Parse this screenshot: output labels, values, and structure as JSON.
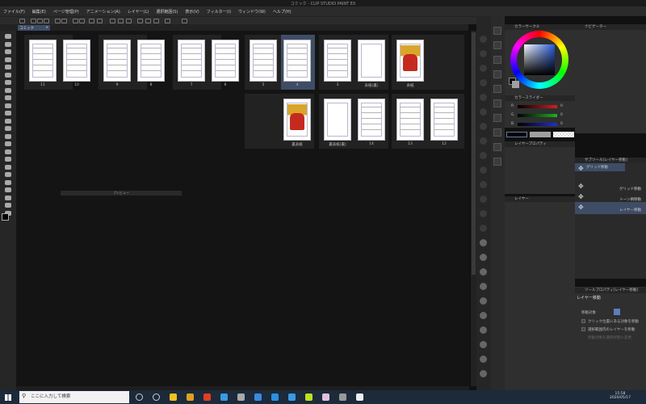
{
  "window": {
    "title": "コミック - CLIP STUDIO PAINT EX"
  },
  "menu": [
    "ファイル(F)",
    "編集(E)",
    "ページ管理(P)",
    "アニメーション(A)",
    "レイヤー(L)",
    "選択範囲(S)",
    "表示(V)",
    "フィルター(I)",
    "ウィンドウ(W)",
    "ヘルプ(H)"
  ],
  "tab": {
    "label": "コミック",
    "close": "×"
  },
  "spreads": [
    {
      "row": 0,
      "pages": [
        {
          "label": "11",
          "kind": "ink"
        },
        {
          "label": "10",
          "kind": "ink"
        }
      ]
    },
    {
      "row": 0,
      "pages": [
        {
          "label": "9",
          "kind": "ink"
        },
        {
          "label": "8",
          "kind": "ink"
        }
      ]
    },
    {
      "row": 0,
      "pages": [
        {
          "label": "7",
          "kind": "ink"
        },
        {
          "label": "6",
          "kind": "ink"
        }
      ]
    },
    {
      "row": 0,
      "pages": [
        {
          "label": "5",
          "kind": "ink"
        },
        {
          "label": "4",
          "kind": "ink",
          "selected": true
        }
      ]
    },
    {
      "row": 0,
      "pages": [
        {
          "label": "3",
          "kind": "ink"
        },
        {
          "label": "表紙(裏)",
          "kind": "blank"
        }
      ]
    },
    {
      "row": 0,
      "pages": [
        {
          "label": "表紙",
          "kind": "color"
        }
      ]
    },
    {
      "row": 1,
      "pages": [
        {
          "label": "",
          "kind": "none"
        },
        {
          "label": "裏表紙",
          "kind": "color"
        }
      ]
    },
    {
      "row": 1,
      "pages": [
        {
          "label": "裏表紙(裏)",
          "kind": "blank"
        },
        {
          "label": "14",
          "kind": "ink"
        }
      ]
    },
    {
      "row": 1,
      "pages": [
        {
          "label": "13",
          "kind": "ink"
        },
        {
          "label": "12",
          "kind": "ink"
        }
      ]
    }
  ],
  "preview": {
    "title": "プレビュー"
  },
  "color_panel": {
    "title": "カラーサークル",
    "main_color": "#000000",
    "sub_color": "#a0a0a0"
  },
  "color_slider": {
    "title": "カラースライダー",
    "tab2": "中間色",
    "channels": [
      {
        "name": "R",
        "value": "0",
        "color": "#d02020"
      },
      {
        "name": "G",
        "value": "0",
        "color": "#20b020"
      },
      {
        "name": "B",
        "value": "0",
        "color": "#2030d0"
      }
    ]
  },
  "navigator": {
    "title": "ナビゲーター"
  },
  "layer_property": {
    "title": "レイヤープロパティ",
    "tab2": "レイヤー検索"
  },
  "layers": {
    "title": "レイヤー"
  },
  "subtool": {
    "title": "サブツール[レイヤー移動]",
    "items": [
      {
        "label": "グリッド移動",
        "selected": true
      },
      {
        "label": "グリッド移動"
      },
      {
        "label": "トーン柄移動"
      },
      {
        "label": "レイヤー移動",
        "selected": true
      }
    ]
  },
  "tool_property": {
    "title": "ツールプロパティ[レイヤー移動]",
    "tool_name": "レイヤー移動",
    "target_label": "移動対象",
    "opt1": "クリック位置にある対象を移動",
    "opt2": "選択範囲内のレイヤーを移動",
    "opt3": "移動対象を選択状態に変更"
  },
  "taskbar": {
    "search_placeholder": "ここに入力して検索",
    "time": "15:58",
    "date": "2020/05/17"
  }
}
